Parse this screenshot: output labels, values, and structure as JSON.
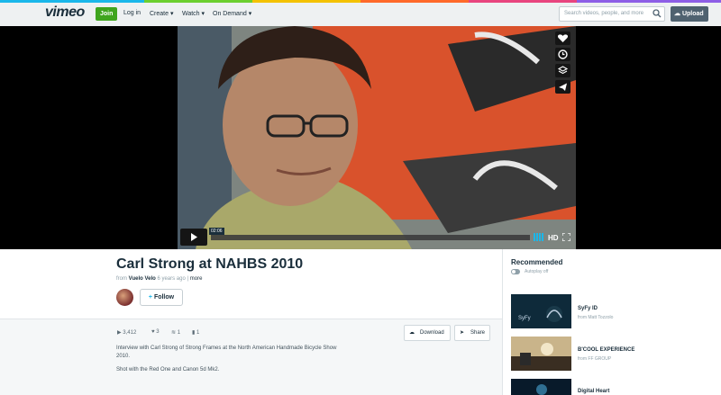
{
  "header": {
    "logo": "vimeo",
    "join": "Join",
    "login": "Log in",
    "create": "Create",
    "watch": "Watch",
    "on_demand": "On Demand",
    "search_placeholder": "Search videos, people, and more",
    "upload": "Upload"
  },
  "player": {
    "time": "02:06",
    "hd": "HD"
  },
  "video": {
    "title": "Carl Strong at NAHBS 2010",
    "from": "from",
    "author": "Vuelo Velo",
    "age": "6 years ago",
    "more": "more",
    "follow": "Follow"
  },
  "stats": {
    "plays": "3,412",
    "likes": "3",
    "collections": "1",
    "comments": "1",
    "download": "Download",
    "share": "Share"
  },
  "description": {
    "line1": "Interview with Carl Strong of Strong Frames at the North American Handmade Bicycle Show",
    "line2": "2010.",
    "line3": "Shot with the Red One and Canon 5d Mk2."
  },
  "sidebar": {
    "heading": "Recommended",
    "autoplay": "Autoplay off",
    "items": [
      {
        "title": "SyFy ID",
        "by": "from Matt Tozzolo"
      },
      {
        "title": "B'COOL EXPERIENCE",
        "by": "from FF GROUP"
      },
      {
        "title": "Digital Heart",
        "by": ""
      }
    ]
  },
  "colors": {
    "accent": "#1ab7ea",
    "join": "#3fa51e",
    "text": "#1a2e3b"
  }
}
